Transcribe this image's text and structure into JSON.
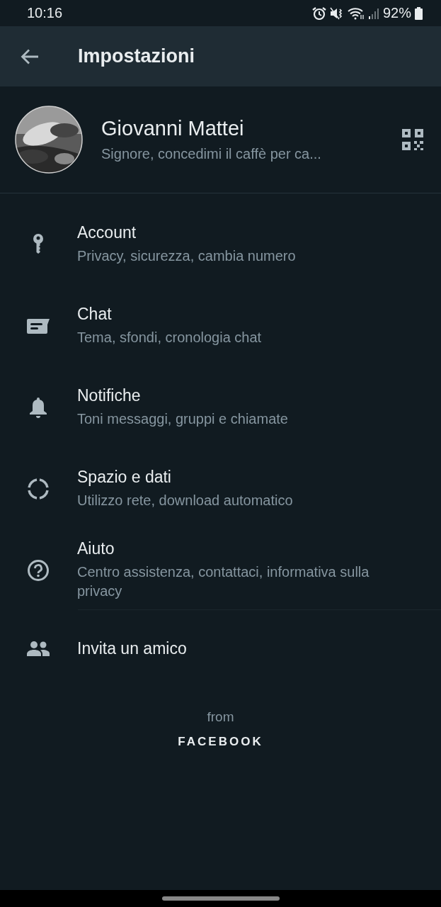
{
  "status_bar": {
    "time": "10:16",
    "battery": "92%"
  },
  "app_bar": {
    "title": "Impostazioni"
  },
  "profile": {
    "name": "Giovanni Mattei",
    "status": "Signore, concedimi il caffè per ca..."
  },
  "settings": [
    {
      "kind": "key",
      "title": "Account",
      "subtitle": "Privacy, sicurezza, cambia numero"
    },
    {
      "kind": "chat",
      "title": "Chat",
      "subtitle": "Tema, sfondi, cronologia chat"
    },
    {
      "kind": "bell",
      "title": "Notifiche",
      "subtitle": "Toni messaggi, gruppi e chiamate"
    },
    {
      "kind": "data",
      "title": "Spazio e dati",
      "subtitle": "Utilizzo rete, download automatico"
    },
    {
      "kind": "help",
      "title": "Aiuto",
      "subtitle": "Centro assistenza, contattaci, informativa sulla privacy"
    }
  ],
  "invite": {
    "kind": "people",
    "title": "Invita un amico"
  },
  "footer": {
    "from": "from",
    "brand": "FACEBOOK"
  }
}
